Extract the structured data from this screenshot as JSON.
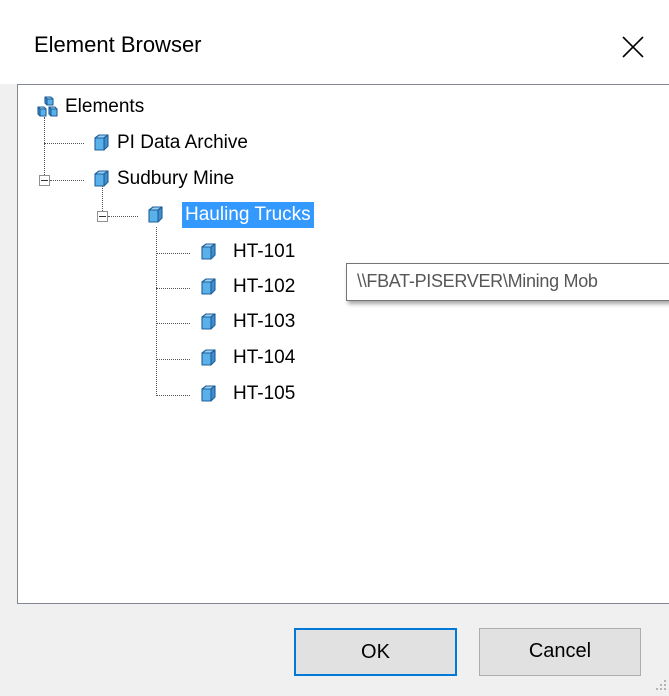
{
  "window": {
    "title": "Element Browser",
    "close_glyph": "✕"
  },
  "tree": {
    "root": {
      "label": "Elements",
      "icon": "elements-root-icon"
    },
    "nodes": [
      {
        "label": "PI Data Archive",
        "icon": "element-cube-icon"
      },
      {
        "label": "Sudbury Mine",
        "icon": "element-cube-icon",
        "expanded": true
      },
      {
        "label": "Hauling Trucks",
        "icon": "element-cube-icon",
        "expanded": true,
        "selected": true
      },
      {
        "label": "HT-101",
        "icon": "element-cube-icon"
      },
      {
        "label": "HT-102",
        "icon": "element-cube-icon"
      },
      {
        "label": "HT-103",
        "icon": "element-cube-icon"
      },
      {
        "label": "HT-104",
        "icon": "element-cube-icon"
      },
      {
        "label": "HT-105",
        "icon": "element-cube-icon"
      }
    ]
  },
  "tooltip": {
    "text": "\\\\FBAT-PISERVER\\Mining Mob"
  },
  "buttons": {
    "ok": "OK",
    "cancel": "Cancel"
  },
  "colors": {
    "selection": "#3399ff",
    "ok_border": "#0078d7",
    "cube_fill": "#5ab0e8",
    "cube_stroke": "#1f5f99"
  }
}
